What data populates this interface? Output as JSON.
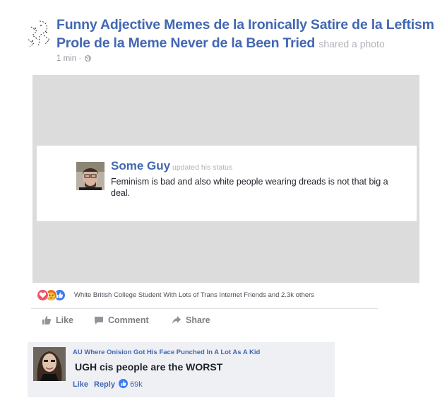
{
  "post": {
    "page_name": "Funny Adjective Memes de la Ironically Satire de la Leftism Prole de la Meme Never de la Been Tried",
    "action": "shared a photo",
    "time": "1 min",
    "separator": "·"
  },
  "status_card": {
    "author": "Some Guy",
    "action": "updated his status",
    "text": "Feminism is bad and also white people wearing dreads is not that big a deal."
  },
  "reactions": {
    "icons": [
      "love-icon",
      "angry-icon",
      "like-icon"
    ],
    "summary": "White British College Student With Lots of Trans Internet Friends and 2.3k others"
  },
  "action_bar": {
    "like": "Like",
    "comment": "Comment",
    "share": "Share"
  },
  "comment": {
    "author": "AU Where Onision Got His Face Punched In A Lot As A Kid",
    "text": "UGH cis people are the WORST",
    "like": "Like",
    "reply": "Reply",
    "like_count": "69k"
  },
  "colors": {
    "link_blue": "#4267b2",
    "gray_text": "#90949c",
    "photo_bg": "#dcdcdc",
    "comment_bg": "#eef0f4"
  }
}
